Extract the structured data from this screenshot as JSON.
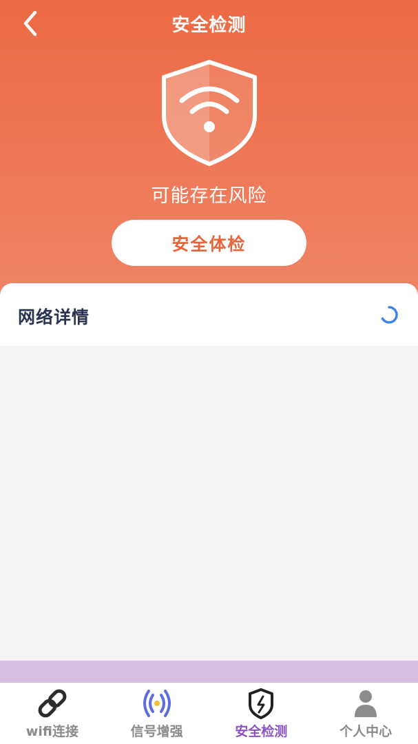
{
  "header": {
    "title": "安全检测",
    "back_icon": "chevron-left-icon"
  },
  "status": {
    "shield_icon": "wifi-shield-icon",
    "risk_text": "可能存在风险"
  },
  "actions": {
    "check_label": "安全体检"
  },
  "details": {
    "title": "网络详情",
    "loading_icon": "loading-spinner-icon"
  },
  "tabs": [
    {
      "label": "wifi连接",
      "icon": "link-icon",
      "active": false
    },
    {
      "label": "信号增强",
      "icon": "signal-icon",
      "active": false
    },
    {
      "label": "安全检测",
      "icon": "shield-bolt-icon",
      "active": true
    },
    {
      "label": "个人中心",
      "icon": "user-icon",
      "active": false
    }
  ],
  "colors": {
    "header_gradient_top": "#ec6a44",
    "header_gradient_bottom": "#ef8467",
    "button_text": "#e8653c",
    "active_tab": "#8a54c4",
    "inactive_tab": "#8a8a8a",
    "strip": "#d6bfe3",
    "spinner": "#3a86e8"
  }
}
